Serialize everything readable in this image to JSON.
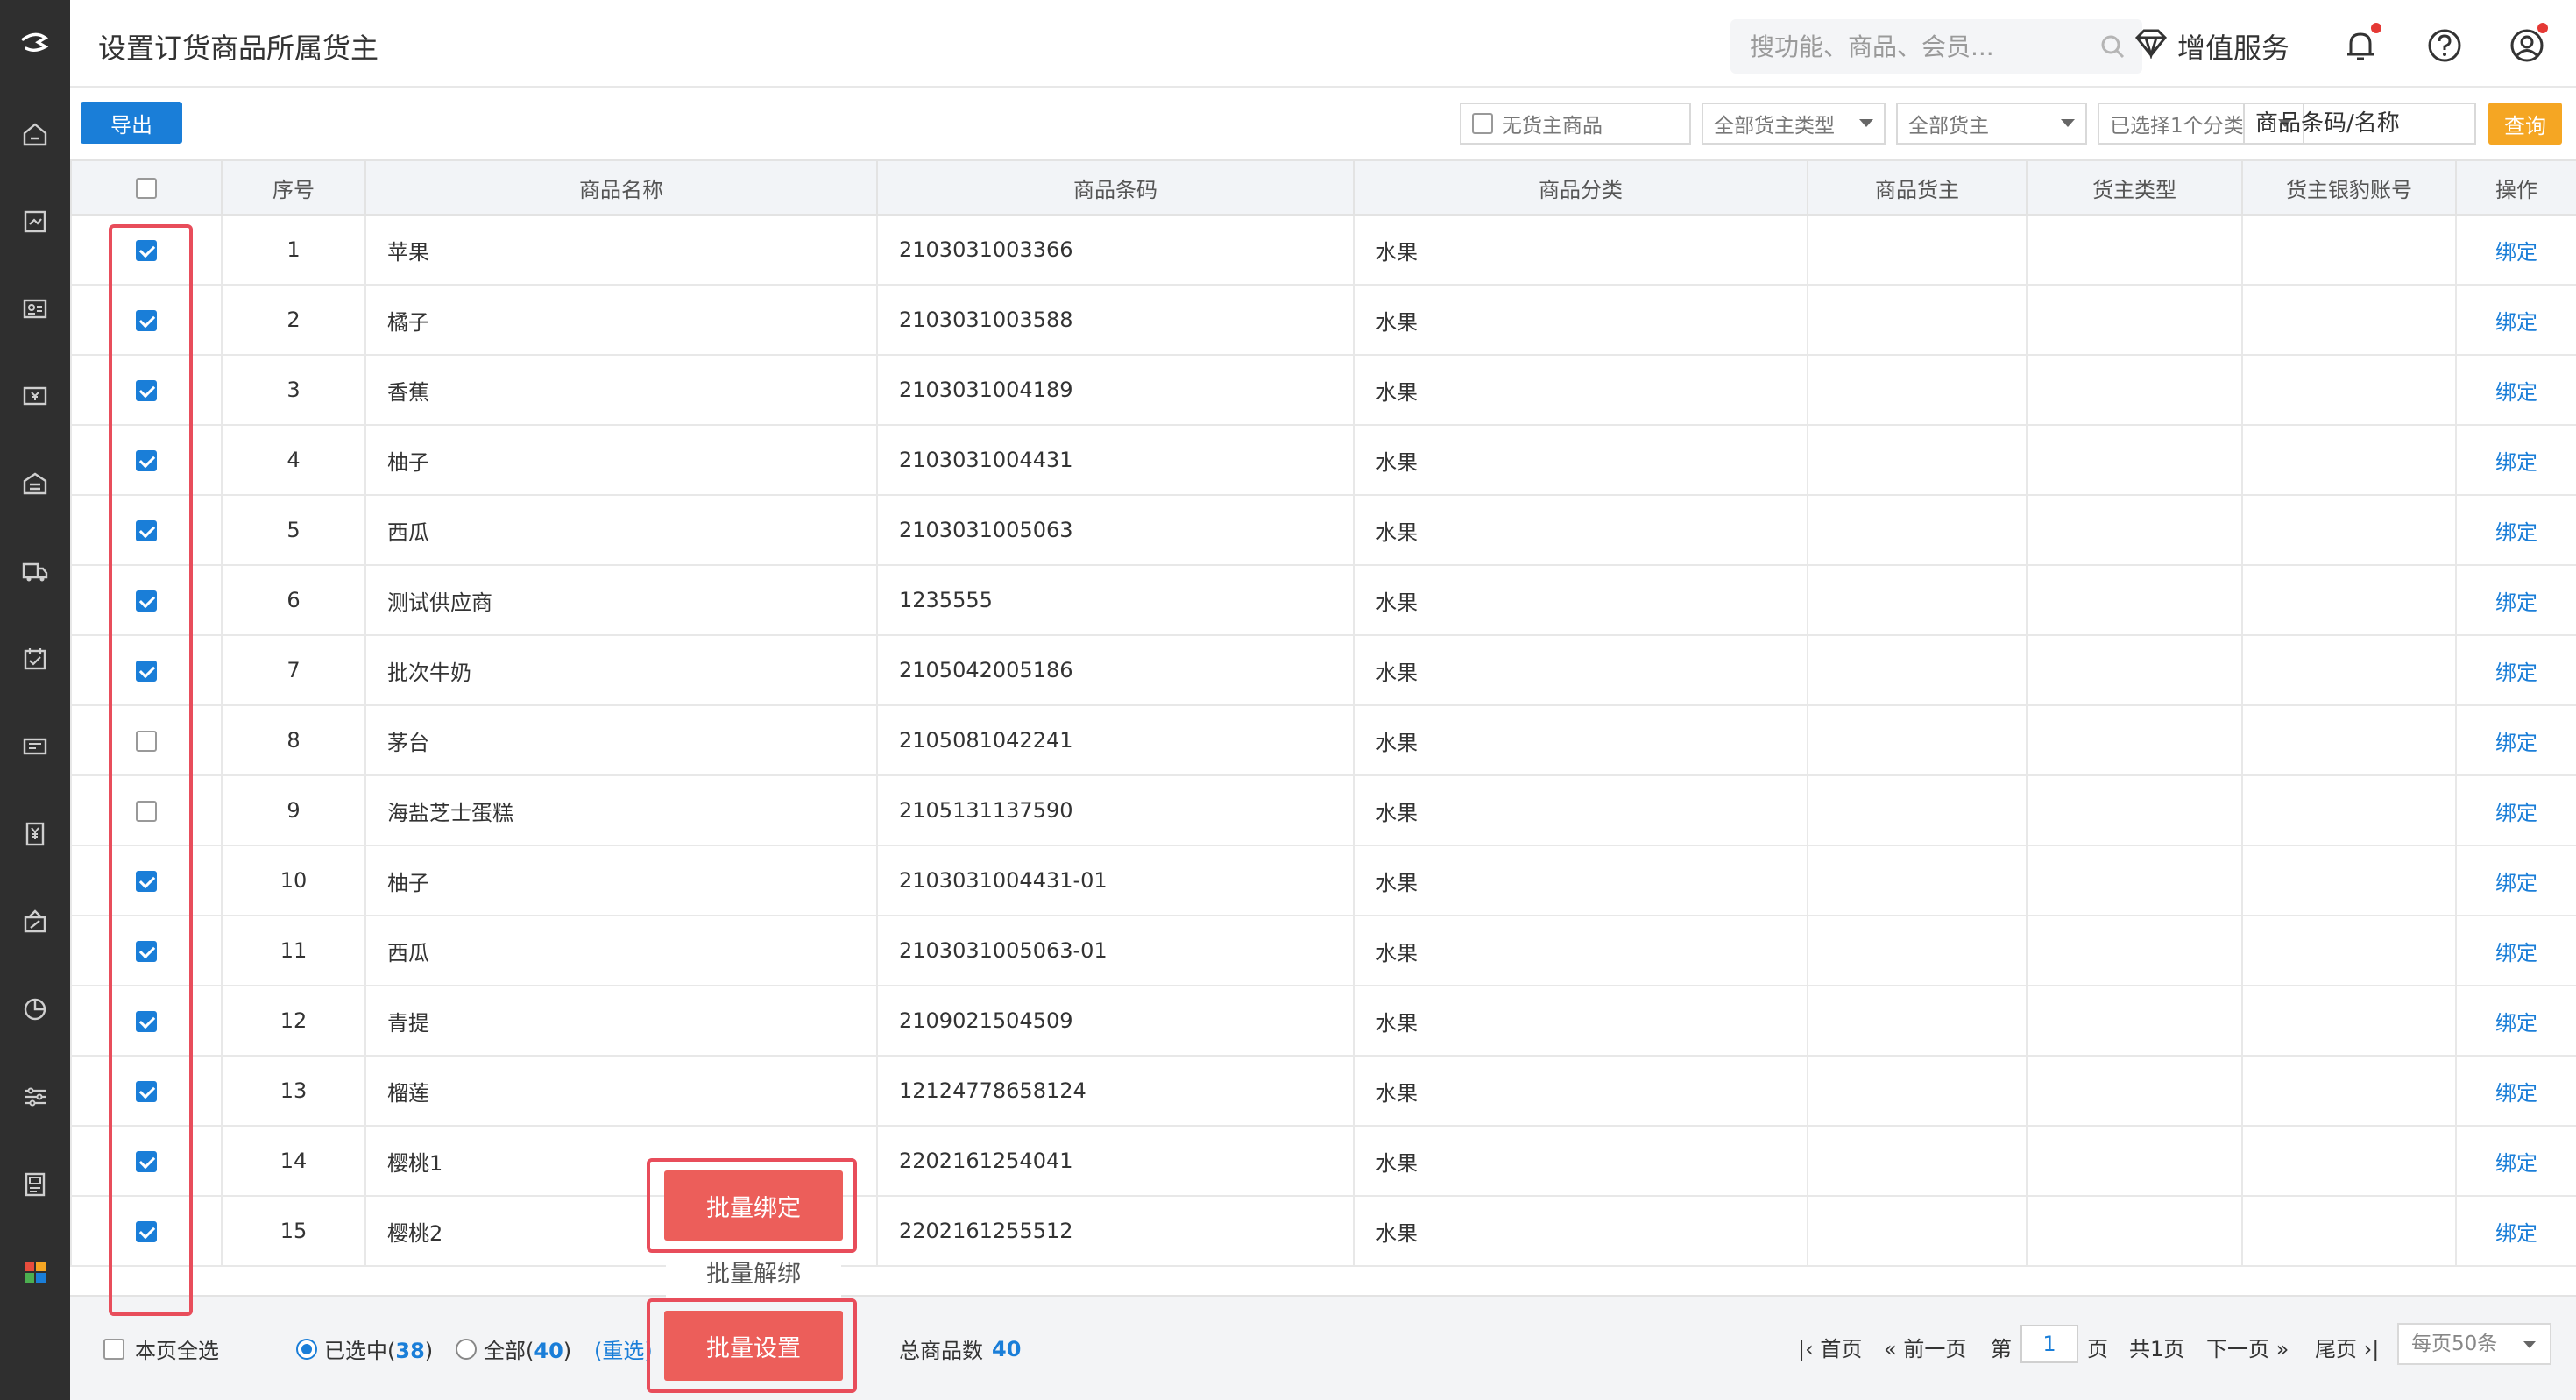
{
  "header": {
    "title": "设置订货商品所属货主",
    "search_placeholder": "搜功能、商品、会员...",
    "value_added_label": "增值服务"
  },
  "toolbar": {
    "export_label": "导出",
    "no_owner_label": "无货主商品",
    "owner_type_select": "全部货主类型",
    "owner_select": "全部货主",
    "category_select": "已选择1个分类",
    "search_value": "商品条码/名称",
    "query_label": "查询"
  },
  "table": {
    "headers": [
      "序号",
      "商品名称",
      "商品条码",
      "商品分类",
      "商品货主",
      "货主类型",
      "货主银豹账号",
      "操作"
    ],
    "action_label": "绑定",
    "rows": [
      {
        "no": "1",
        "name": "苹果",
        "barcode": "2103031003366",
        "category": "水果",
        "checked": true
      },
      {
        "no": "2",
        "name": "橘子",
        "barcode": "2103031003588",
        "category": "水果",
        "checked": true
      },
      {
        "no": "3",
        "name": "香蕉",
        "barcode": "2103031004189",
        "category": "水果",
        "checked": true
      },
      {
        "no": "4",
        "name": "柚子",
        "barcode": "2103031004431",
        "category": "水果",
        "checked": true
      },
      {
        "no": "5",
        "name": "西瓜",
        "barcode": "2103031005063",
        "category": "水果",
        "checked": true
      },
      {
        "no": "6",
        "name": "测试供应商",
        "barcode": "1235555",
        "category": "水果",
        "checked": true
      },
      {
        "no": "7",
        "name": "批次牛奶",
        "barcode": "2105042005186",
        "category": "水果",
        "checked": true
      },
      {
        "no": "8",
        "name": "茅台",
        "barcode": "2105081042241",
        "category": "水果",
        "checked": false
      },
      {
        "no": "9",
        "name": "海盐芝士蛋糕",
        "barcode": "2105131137590",
        "category": "水果",
        "checked": false
      },
      {
        "no": "10",
        "name": "柚子",
        "barcode": "2103031004431-01",
        "category": "水果",
        "checked": true
      },
      {
        "no": "11",
        "name": "西瓜",
        "barcode": "2103031005063-01",
        "category": "水果",
        "checked": true
      },
      {
        "no": "12",
        "name": "青提",
        "barcode": "2109021504509",
        "category": "水果",
        "checked": true
      },
      {
        "no": "13",
        "name": "榴莲",
        "barcode": "12124778658124",
        "category": "水果",
        "checked": true
      },
      {
        "no": "14",
        "name": "樱桃1",
        "barcode": "2202161254041",
        "category": "水果",
        "checked": true
      },
      {
        "no": "15",
        "name": "樱桃2",
        "barcode": "2202161255512",
        "category": "水果",
        "checked": true
      }
    ]
  },
  "bottom": {
    "page_select_all": "本页全选",
    "selected_prefix": "已选中(",
    "selected_count": "38",
    "selected_suffix": ")",
    "all_prefix": "全部(",
    "all_count": "40",
    "all_suffix": ")",
    "reselect": "(重选)",
    "batch_bind": "批量绑定",
    "batch_unbind": "批量解绑",
    "batch_set": "批量设置",
    "total_label": "总商品数",
    "total_count": "40"
  },
  "pager": {
    "first": "首页",
    "prev": "前一页",
    "page_prefix": "第",
    "page_value": "1",
    "page_suffix": "页",
    "total_pages": "共1页",
    "next": "下一页",
    "last": "尾页",
    "per_page": "每页50条"
  },
  "colors": {
    "primary": "#1a7ed8",
    "query": "#f5a623",
    "danger": "#ec5e5a",
    "highlight": "#e84d5b",
    "rail": "#2f2f2f"
  }
}
